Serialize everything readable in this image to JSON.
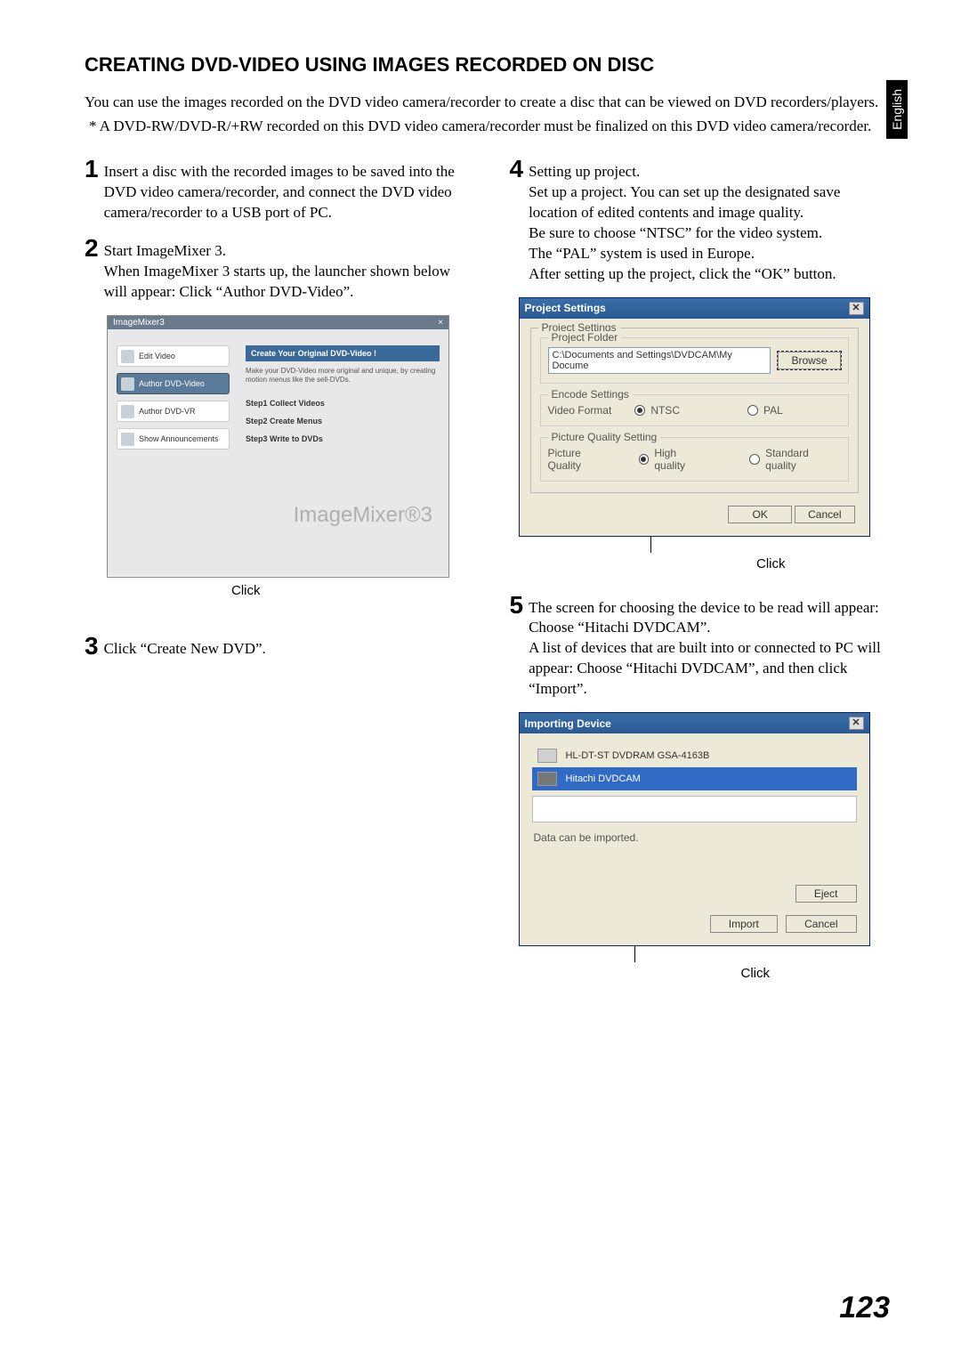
{
  "lang_tab": "English",
  "section_title": "CREATING DVD-VIDEO USING IMAGES RECORDED ON DISC",
  "intro": "You can use the images recorded on the DVD video camera/recorder to create a disc that can be viewed on DVD recorders/players.",
  "footnote": "* A DVD-RW/DVD-R/+RW recorded on this DVD video camera/recorder must be finalized on this DVD video camera/recorder.",
  "steps": {
    "s1": {
      "num": "1",
      "body": "Insert a disc with the recorded images to be saved into the DVD video camera/recorder, and connect the DVD video camera/recorder to a USB port of PC."
    },
    "s2": {
      "num": "2",
      "body": "Start ImageMixer 3.\nWhen ImageMixer 3 starts up, the launcher shown below will appear: Click “Author DVD-Video”."
    },
    "s3": {
      "num": "3",
      "body": "Click “Create New DVD”."
    },
    "s4": {
      "num": "4",
      "body": "Setting up project.\nSet up a project. You can set up the designated save location of edited contents and image quality.\nBe sure to choose “NTSC” for the video system.\nThe “PAL” system is used in Europe.\nAfter setting up the project, click the “OK” button."
    },
    "s5": {
      "num": "5",
      "body": "The screen for choosing the device to be read will appear: Choose “Hitachi DVDCAM”.\nA list of devices that are built into or connected to PC will appear: Choose “Hitachi DVDCAM”, and then click “Import”."
    }
  },
  "click_label": "Click",
  "launcher": {
    "app_title": "ImageMixer3",
    "close": "×",
    "items": [
      "Edit Video",
      "Author DVD-Video",
      "Author DVD-VR",
      "Show Announcements"
    ],
    "panel_heading": "Create Your Original DVD-Video !",
    "panel_desc": "Make your DVD-Video more original and unique, by creating motion menus like the sell-DVDs.",
    "panel_steps": [
      "Step1 Collect Videos",
      "Step2 Create Menus",
      "Step3 Write to DVDs"
    ],
    "logo": "ImageMixer®3"
  },
  "project_settings": {
    "title": "Project Settings",
    "group_label": "Project Settings",
    "folder_label": "Project Folder",
    "folder_value": "C:\\Documents and Settings\\DVDCAM\\My Docume",
    "browse": "Browse",
    "encode_label": "Encode Settings",
    "video_format_label": "Video Format",
    "ntsc": "NTSC",
    "pal": "PAL",
    "pq_group": "Picture Quality Setting",
    "pq_label": "Picture Quality",
    "pq_high": "High quality",
    "pq_std": "Standard quality",
    "ok": "OK",
    "cancel": "Cancel"
  },
  "importing_device": {
    "title": "Importing Device",
    "item1": "HL-DT-ST DVDRAM GSA-4163B",
    "item2": "Hitachi DVDCAM",
    "status": "Data can be imported.",
    "eject": "Eject",
    "import": "Import",
    "cancel": "Cancel"
  },
  "page_number": "123"
}
